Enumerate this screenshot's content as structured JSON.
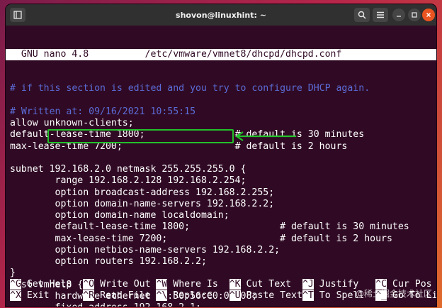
{
  "window": {
    "title": "shovon@linuxhint: ~",
    "new_tab_icon": "new-tab-icon",
    "search_icon": "search-icon",
    "menu_icon": "hamburger-menu-icon",
    "minimize_icon": "minimize-icon",
    "maximize_icon": "maximize-icon",
    "close_icon": "close-icon"
  },
  "nano": {
    "header": "  GNU nano 4.8          /etc/vmware/vmnet8/dhcpd/dhcpd.conf",
    "lines": [
      {
        "text": "# if this section is edited and you try to configure DHCP again.",
        "type": "comment"
      },
      {
        "text": "",
        "type": "code"
      },
      {
        "text": "# Written at: 09/16/2021 10:55:15",
        "type": "comment"
      },
      {
        "text": "allow unknown-clients;",
        "type": "code"
      },
      {
        "text": "default-lease-time 1800;                # default is 30 minutes",
        "type": "code"
      },
      {
        "text": "max-lease-time 7200;                    # default is 2 hours",
        "type": "code"
      },
      {
        "text": "",
        "type": "code"
      },
      {
        "text": "subnet 192.168.2.0 netmask 255.255.255.0 {",
        "type": "code"
      },
      {
        "text": "        range 192.168.2.128 192.168.2.254;",
        "type": "code"
      },
      {
        "text": "        option broadcast-address 192.168.2.255;",
        "type": "code"
      },
      {
        "text": "        option domain-name-servers 192.168.2.2;",
        "type": "code"
      },
      {
        "text": "        option domain-name localdomain;",
        "type": "code"
      },
      {
        "text": "        default-lease-time 1800;                # default is 30 minutes",
        "type": "code"
      },
      {
        "text": "        max-lease-time 7200;                    # default is 2 hours",
        "type": "code"
      },
      {
        "text": "        option netbios-name-servers 192.168.2.2;",
        "type": "code"
      },
      {
        "text": "        option routers 192.168.2.2;",
        "type": "code"
      },
      {
        "text": "}",
        "type": "code"
      },
      {
        "text": "host vmnet8 {",
        "type": "code"
      },
      {
        "text": "        hardware ethernet 00:50:56:C0:00:08;",
        "type": "code"
      },
      {
        "text": "        fixed-address 192.168.2.1;",
        "type": "code"
      }
    ],
    "shortcuts_row1": [
      {
        "key": "^G",
        "label": " Get Help  "
      },
      {
        "key": "^O",
        "label": " Write Out "
      },
      {
        "key": "^W",
        "label": " Where Is  "
      },
      {
        "key": "^K",
        "label": " Cut Text  "
      },
      {
        "key": "^J",
        "label": " Justify   "
      },
      {
        "key": "^C",
        "label": " Cur Pos"
      }
    ],
    "shortcuts_row2": [
      {
        "key": "^X",
        "label": " Exit      "
      },
      {
        "key": "^R",
        "label": " Read File "
      },
      {
        "key": "^\\",
        "label": " Replace   "
      },
      {
        "key": "^U",
        "label": " Paste Text"
      },
      {
        "key": "^T",
        "label": " To Spell  "
      },
      {
        "key": "^_",
        "label": " Go To Line"
      }
    ]
  },
  "annotation": {
    "highlight_color": "#22c02a"
  },
  "watermark": "@稀土掘金技术社区",
  "colors": {
    "terminal_bg": "#300a24",
    "comment": "#5b6bd6",
    "titlebar": "#303030",
    "close_button": "#e95420"
  }
}
